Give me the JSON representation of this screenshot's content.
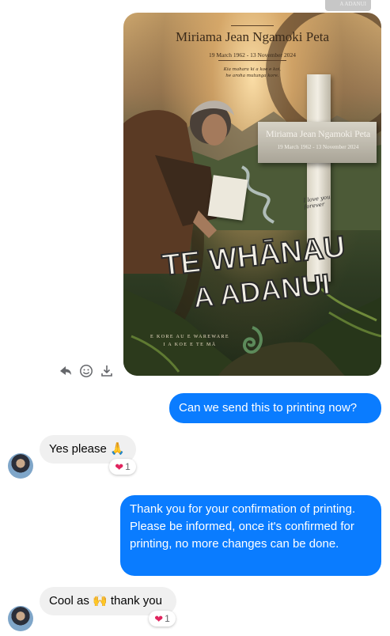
{
  "thumbnail": {
    "caption": "A ADANUI"
  },
  "poster": {
    "name": "Miriama Jean Ngamoki Peta",
    "dates": "19 March 1962 - 13 November 2024",
    "quote_line1": "Kia mahara ki a koe e koi,",
    "quote_line2": "he aroha mutunga kore.",
    "cross_name": "Miriama Jean Ngamoki Peta",
    "cross_dates": "19 March 1962 - 13 November 2024",
    "cross_note": "I love you forever",
    "graffiti_line1": "TE WHĀNAU",
    "graffiti_line2": "A ADANUI",
    "footer_line1": "E KORE AU E WAREWARE",
    "footer_line2": "I A KOE E TE MĀ"
  },
  "actions": [
    "share-icon",
    "emoji-icon",
    "download-icon"
  ],
  "messages": [
    {
      "direction": "outgoing",
      "text": "Can we send this to printing now?"
    },
    {
      "direction": "incoming",
      "text": "Yes please 🙏",
      "reaction": {
        "emoji": "❤",
        "count": "1"
      }
    },
    {
      "direction": "outgoing",
      "text": "Thank you for your confirmation of printing. Please be informed, once it's confirmed for printing, no more changes can be done."
    },
    {
      "direction": "incoming",
      "text": "Cool as 🙌 thank you",
      "reaction": {
        "emoji": "❤",
        "count": "1"
      }
    }
  ],
  "colors": {
    "outgoing_bubble": "#0a7cff",
    "incoming_bubble": "#f0f0f0",
    "reaction_heart": "#e0245e"
  }
}
